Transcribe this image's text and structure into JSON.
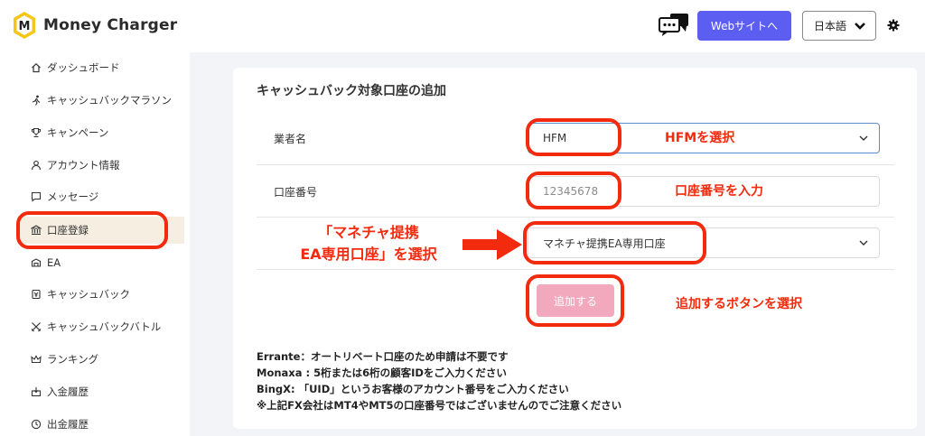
{
  "header": {
    "brand": "Money Charger",
    "logo_letter": "M",
    "website_button": "Webサイトへ",
    "language": "日本語"
  },
  "sidebar": {
    "items": [
      {
        "label": "ダッシュボード",
        "icon": "home-icon"
      },
      {
        "label": "キャッシュバックマラソン",
        "icon": "runner-icon"
      },
      {
        "label": "キャンペーン",
        "icon": "trophy-icon"
      },
      {
        "label": "アカウント情報",
        "icon": "user-icon"
      },
      {
        "label": "メッセージ",
        "icon": "message-icon"
      },
      {
        "label": "口座登録",
        "icon": "bank-icon",
        "active": true
      },
      {
        "label": "EA",
        "icon": "ea-icon"
      },
      {
        "label": "キャッシュバック",
        "icon": "cashback-icon"
      },
      {
        "label": "キャッシュバックバトル",
        "icon": "battle-icon"
      },
      {
        "label": "ランキング",
        "icon": "crown-icon"
      },
      {
        "label": "入金履歴",
        "icon": "deposit-icon"
      },
      {
        "label": "出金履歴",
        "icon": "withdraw-icon"
      }
    ]
  },
  "form": {
    "title": "キャッシュバック対象口座の追加",
    "broker_label": "業者名",
    "broker_value": "HFM",
    "account_label": "口座番号",
    "account_placeholder": "12345678",
    "account_type_value": "マネチャ提携EA専用口座",
    "submit_label": "追加する"
  },
  "annotations": {
    "select_broker": "HFMを選択",
    "enter_account": "口座番号を入力",
    "select_type_line1": "「マネチャ提携",
    "select_type_line2": "EA専用口座」を選択",
    "click_add": "追加するボタンを選択"
  },
  "notes": [
    "Errante：オートリベート口座のため申請は不要です",
    "Monaxa : 5桁または6桁の顧客IDをご入力ください",
    "BingX: 「UID」というお客様のアカウント番号をご入力ください",
    "※上記FX会社はMT4やMT5の口座番号ではございませんのでご注意ください"
  ],
  "colors": {
    "accent": "#5b5ef0",
    "highlight": "#f22a0e",
    "submit_disabled": "#f3a9bd",
    "logo_yellow": "#f5c518"
  }
}
